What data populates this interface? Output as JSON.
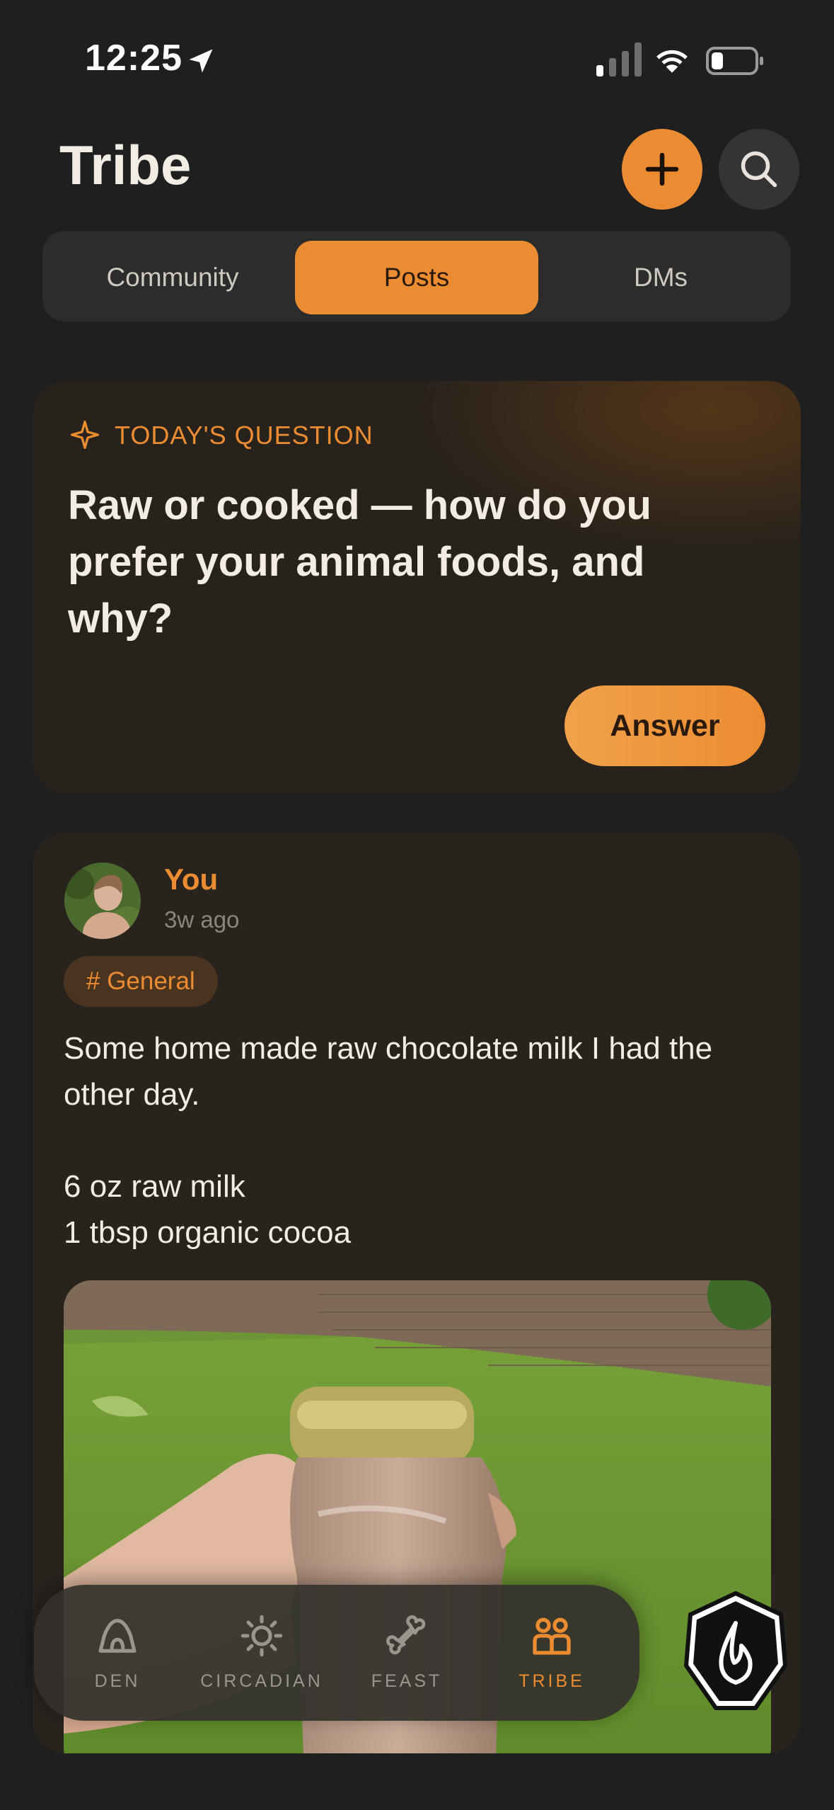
{
  "status_bar": {
    "time": "12:25"
  },
  "header": {
    "title": "Tribe"
  },
  "tabs": [
    {
      "label": "Community",
      "active": false
    },
    {
      "label": "Posts",
      "active": true
    },
    {
      "label": "DMs",
      "active": false
    }
  ],
  "question": {
    "label": "TODAY'S QUESTION",
    "text": "Raw or cooked — how do you prefer your animal foods, and why?",
    "answer_label": "Answer"
  },
  "post": {
    "author": "You",
    "time_ago": "3w ago",
    "tag": "# General",
    "body_lines": [
      "Some home made raw chocolate milk I had the other day.",
      "",
      "6 oz raw milk",
      "1 tbsp organic cocoa"
    ]
  },
  "nav": [
    {
      "label": "DEN",
      "icon": "den-icon",
      "active": false
    },
    {
      "label": "CIRCADIAN",
      "icon": "sun-icon",
      "active": false
    },
    {
      "label": "FEAST",
      "icon": "bone-icon",
      "active": false
    },
    {
      "label": "TRIBE",
      "icon": "tribe-icon",
      "active": true
    }
  ],
  "colors": {
    "accent": "#ec8c32",
    "background": "#1f1f1f",
    "card": "#28221c"
  }
}
